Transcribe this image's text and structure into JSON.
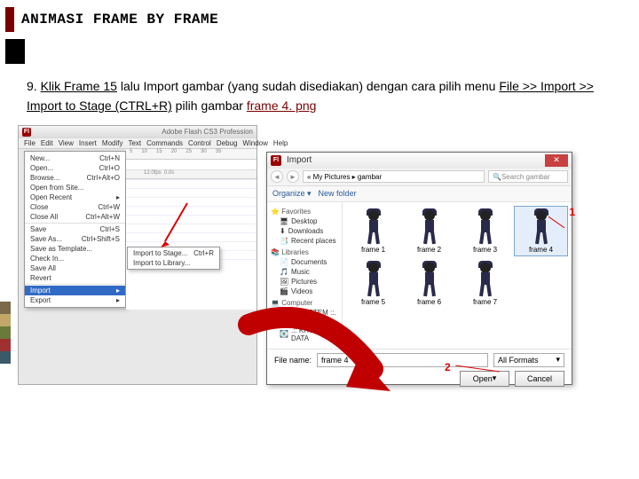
{
  "slide": {
    "title": "ANIMASI FRAME BY FRAME",
    "step_num": "9.",
    "text_1": "Klik Frame 15",
    "text_2": " lalu Import gambar (yang sudah disediakan) dengan cara pilih menu ",
    "text_3": "File >> Import >> Import to Stage (CTRL+R)",
    "text_4": " pilih gambar ",
    "text_5": "frame 4. png"
  },
  "flash": {
    "app_title": "Adobe Flash CS3 Profession",
    "logo": "Fl",
    "menus": [
      "File",
      "Edit",
      "View",
      "Insert",
      "Modify",
      "Text",
      "Commands",
      "Control",
      "Debug",
      "Window",
      "Help"
    ],
    "ruler": [
      "5",
      "10",
      "15",
      "20",
      "25",
      "30",
      "35"
    ],
    "file_menu": [
      {
        "l": "New...",
        "r": "Ctrl+N"
      },
      {
        "l": "Open...",
        "r": "Ctrl+O"
      },
      {
        "l": "Browse...",
        "r": "Ctrl+Alt+O"
      },
      {
        "l": "Open from Site...",
        "r": ""
      },
      {
        "l": "Open Recent",
        "r": "▸"
      },
      {
        "l": "Close",
        "r": "Ctrl+W"
      },
      {
        "l": "Close All",
        "r": "Ctrl+Alt+W"
      },
      {
        "sep": true
      },
      {
        "l": "Save",
        "r": "Ctrl+S"
      },
      {
        "l": "Save As...",
        "r": "Ctrl+Shift+S"
      },
      {
        "l": "Save as Template...",
        "r": ""
      },
      {
        "l": "Check In...",
        "r": ""
      },
      {
        "l": "Save All",
        "r": ""
      },
      {
        "l": "Revert",
        "r": ""
      },
      {
        "sep": true
      },
      {
        "l": "Import",
        "r": "▸",
        "hl": true
      },
      {
        "l": "Export",
        "r": "▸"
      }
    ],
    "import_submenu": [
      {
        "l": "Import to Stage...",
        "r": "Ctrl+R"
      },
      {
        "l": "Import to Library...",
        "r": ""
      }
    ],
    "fps": "12.0fps",
    "time": "0.0s"
  },
  "import_dialog": {
    "title": "Import",
    "logo": "Fl",
    "path": "« My Pictures ▸ gambar",
    "search_ph": "Search gambar",
    "organize": "Organize ▾",
    "newfolder": "New folder",
    "sidebar": {
      "favorites": "Favorites",
      "fav_items": [
        "Desktop",
        "Downloads",
        "Recent places"
      ],
      "libraries": "Libraries",
      "lib_items": [
        "Documents",
        "Music",
        "Pictures",
        "Videos"
      ],
      "computer": "Computer",
      "comp_items": [
        ".:: SYSTEM ::. (C:)",
        ".:: KHUSUS DATA"
      ]
    },
    "files": [
      "frame 1",
      "frame 2",
      "frame 3",
      "frame 4",
      "frame 5",
      "frame 6",
      "frame 7"
    ],
    "filename_label": "File name:",
    "filename_value": "frame 4",
    "formats": "All Formats",
    "open": "Open",
    "cancel": "Cancel",
    "callout1": "1",
    "callout2": "2"
  }
}
